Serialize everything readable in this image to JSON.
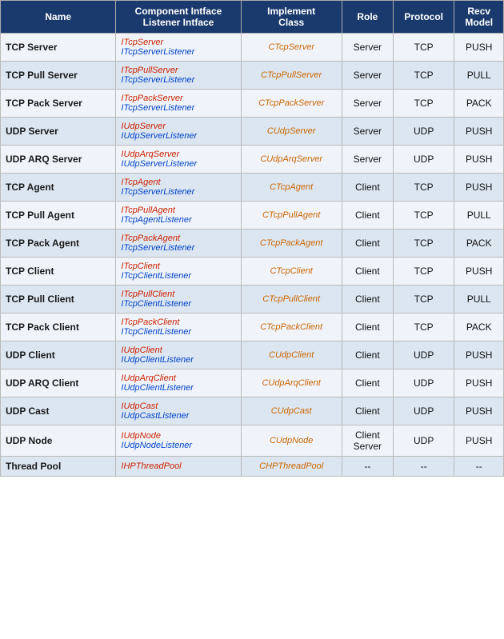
{
  "table": {
    "headers": [
      {
        "label": "Name",
        "id": "name"
      },
      {
        "label": "Component Intface\nListener Intface",
        "id": "interfaces"
      },
      {
        "label": "Implement\nClass",
        "id": "impl"
      },
      {
        "label": "Role",
        "id": "role"
      },
      {
        "label": "Protocol",
        "id": "protocol"
      },
      {
        "label": "Recv\nModel",
        "id": "recv"
      }
    ],
    "rows": [
      {
        "name": "TCP Server",
        "iface1": "ITcpServer",
        "iface2": "ITcpServerListener",
        "impl": "CTcpServer",
        "role": "Server",
        "protocol": "TCP",
        "recv": "PUSH"
      },
      {
        "name": "TCP Pull Server",
        "iface1": "ITcpPullServer",
        "iface2": "ITcpServerListener",
        "impl": "CTcpPullServer",
        "role": "Server",
        "protocol": "TCP",
        "recv": "PULL"
      },
      {
        "name": "TCP Pack Server",
        "iface1": "ITcpPackServer",
        "iface2": "ITcpServerListener",
        "impl": "CTcpPackServer",
        "role": "Server",
        "protocol": "TCP",
        "recv": "PACK"
      },
      {
        "name": "UDP Server",
        "iface1": "IUdpServer",
        "iface2": "IUdpServerListener",
        "impl": "CUdpServer",
        "role": "Server",
        "protocol": "UDP",
        "recv": "PUSH"
      },
      {
        "name": "UDP ARQ Server",
        "iface1": "IUdpArqServer",
        "iface2": "IUdpServerListener",
        "impl": "CUdpArqServer",
        "role": "Server",
        "protocol": "UDP",
        "recv": "PUSH"
      },
      {
        "name": "TCP Agent",
        "iface1": "ITcpAgent",
        "iface2": "ITcpServerListener",
        "impl": "CTcpAgent",
        "role": "Client",
        "protocol": "TCP",
        "recv": "PUSH"
      },
      {
        "name": "TCP Pull Agent",
        "iface1": "ITcpPullAgent",
        "iface2": "ITcpAgentListener",
        "impl": "CTcpPullAgent",
        "role": "Client",
        "protocol": "TCP",
        "recv": "PULL"
      },
      {
        "name": "TCP Pack Agent",
        "iface1": "ITcpPackAgent",
        "iface2": "ITcpServerListener",
        "impl": "CTcpPackAgent",
        "role": "Client",
        "protocol": "TCP",
        "recv": "PACK"
      },
      {
        "name": "TCP Client",
        "iface1": "ITcpClient",
        "iface2": "ITcpClientListener",
        "impl": "CTcpClient",
        "role": "Client",
        "protocol": "TCP",
        "recv": "PUSH"
      },
      {
        "name": "TCP Pull Client",
        "iface1": "ITcpPullClient",
        "iface2": "ITcpClientListener",
        "impl": "CTcpPullClient",
        "role": "Client",
        "protocol": "TCP",
        "recv": "PULL"
      },
      {
        "name": "TCP Pack Client",
        "iface1": "ITcpPackClient",
        "iface2": "ITcpClientListener",
        "impl": "CTcpPackClient",
        "role": "Client",
        "protocol": "TCP",
        "recv": "PACK"
      },
      {
        "name": "UDP Client",
        "iface1": "IUdpClient",
        "iface2": "IUdpClientListener",
        "impl": "CUdpClient",
        "role": "Client",
        "protocol": "UDP",
        "recv": "PUSH"
      },
      {
        "name": "UDP ARQ Client",
        "iface1": "IUdpArqClient",
        "iface2": "IUdpClientListener",
        "impl": "CUdpArqClient",
        "role": "Client",
        "protocol": "UDP",
        "recv": "PUSH"
      },
      {
        "name": "UDP Cast",
        "iface1": "IUdpCast",
        "iface2": "IUdpCastListener",
        "impl": "CUdpCast",
        "role": "Client",
        "protocol": "UDP",
        "recv": "PUSH"
      },
      {
        "name": "UDP Node",
        "iface1": "IUdpNode",
        "iface2": "IUdpNodeListener",
        "impl": "CUdpNode",
        "role": "Client\nServer",
        "protocol": "UDP",
        "recv": "PUSH"
      },
      {
        "name": "Thread Pool",
        "iface1": "IHPThreadPool",
        "iface2": "",
        "impl": "CHPThreadPool",
        "role": "--",
        "protocol": "--",
        "recv": "--"
      }
    ]
  }
}
